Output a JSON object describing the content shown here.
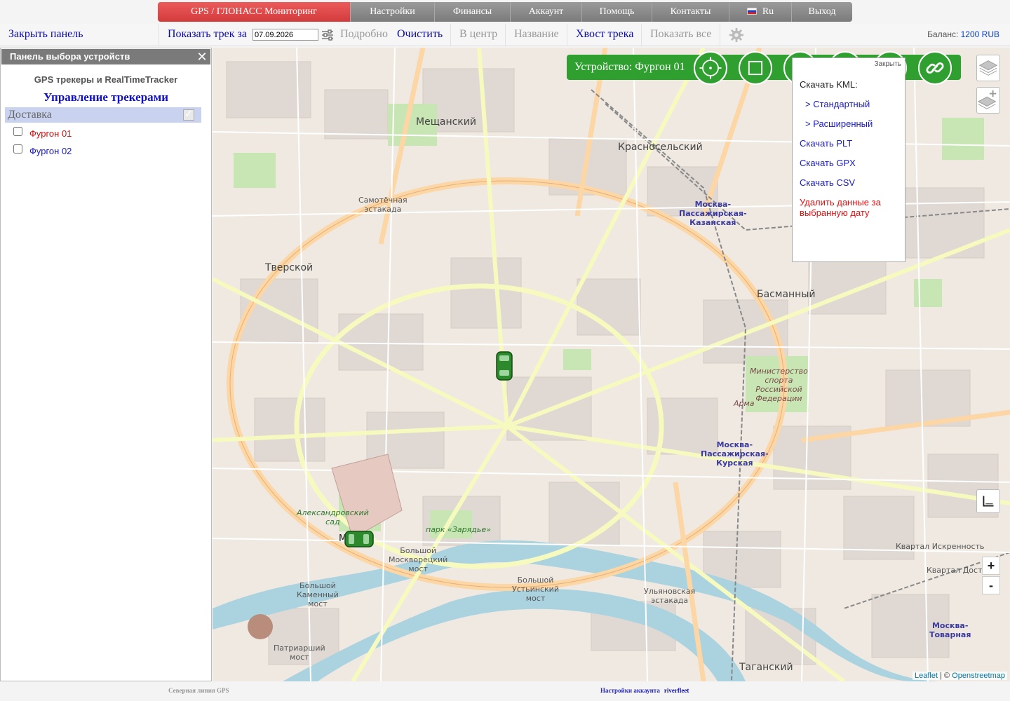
{
  "nav": {
    "brand": "GPS / ГЛОНАСС Мониторинг",
    "items": [
      "Настройки",
      "Финансы",
      "Аккаунт",
      "Помощь",
      "Контакты"
    ],
    "language": "Ru",
    "logout": "Выход"
  },
  "toolbar": {
    "close_panel": "Закрыть панель",
    "show_track": "Показать трек за",
    "date_value": "07.09.2026",
    "details": "Подробно",
    "clear": "Очистить",
    "center": "В центр",
    "name": "Название",
    "track_tail": "Хвост трека",
    "show_all": "Показать все",
    "balance_label": "Баланс:",
    "balance_value": "1200 RUB"
  },
  "panel": {
    "header": "Панель выбора устройств",
    "close": "✕",
    "subtitle": "GPS трекеры и RealTimeTracker",
    "title": "Управление трекерами",
    "group": "Доставка",
    "group_check": "✓",
    "devices": [
      {
        "label": "Фургон 01",
        "color": "#d01010"
      },
      {
        "label": "Фургон 02",
        "color": "#1a1ac0"
      }
    ]
  },
  "map": {
    "device_bar": "Устройство: Фургон 01",
    "popup": {
      "close": "Закрыть",
      "kml_head": "Скачать KML:",
      "kml_standard": "> Стандартный",
      "kml_extended": "> Расширенный",
      "plt": "Скачать PLT",
      "gpx": "Скачать GPX",
      "csv": "Скачать CSV",
      "delete_line1": "Удалить данные за",
      "delete_line2": "выбранную дату"
    },
    "zoom_in": "+",
    "zoom_out": "-",
    "attribution_leaflet": "Leaflet",
    "attribution_sep": " | © ",
    "attribution_osm": "Openstreetmap",
    "labels": {
      "meshchansky": "Мещанский",
      "krasnoselsky": "Красносельский",
      "tverskoy": "Тверской",
      "basmanny": "Басманный",
      "samotechnaya1": "Самотёчная",
      "samotechnaya2": "эстакада",
      "kazan1": "Москва-",
      "kazan2": "Пассажирская-",
      "kazan3": "Казанская",
      "kursk1": "Москва-",
      "kursk2": "Пассажирская-",
      "kursk3": "Курская",
      "bmoskv1": "Большой",
      "bmoskv2": "Москворецкий",
      "bmoskv3": "мост",
      "bkamen1": "Большой",
      "bkamen2": "Каменный",
      "bkamen3": "мост",
      "bust1": "Большой",
      "bust2": "Устьинский",
      "bust3": "мост",
      "patr1": "Патриарший",
      "patr2": "мост",
      "ulyan1": "Ульяновская",
      "ulyan2": "эстакада",
      "taganka": "Таганский",
      "iskrennost": "Квартал Искренность",
      "dostoyan": "Квартал Достоя",
      "tovarnaya1": "Москва-",
      "tovarnaya2": "Товарная",
      "moskva": "Москва",
      "zaryadye": "парк «Зарядье»",
      "alex1": "Александровский",
      "alex2": "сад",
      "minsport1": "Министерство",
      "minsport2": "спорта",
      "minsport3": "Российской",
      "minsport4": "Федерации",
      "armiya": "Арма"
    }
  },
  "footer": {
    "left": "Северная линия GPS",
    "settings": "Настройки аккаунта",
    "user": "riverfleet"
  }
}
